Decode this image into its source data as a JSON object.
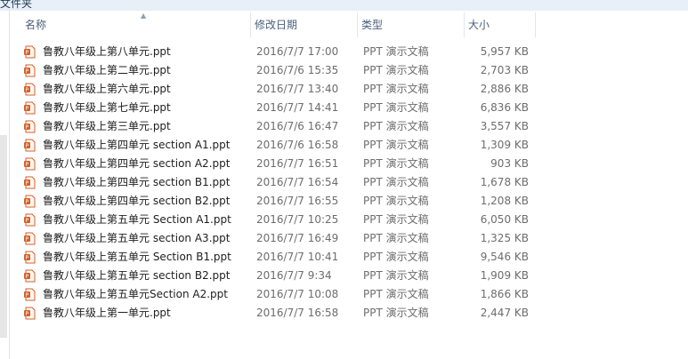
{
  "window": {
    "title_fragment": "文件夹"
  },
  "columns": {
    "name": "名称",
    "date": "修改日期",
    "type": "类型",
    "size": "大小"
  },
  "colors": {
    "header_text": "#4c607a",
    "icon_accent": "#d3622b"
  },
  "files": [
    {
      "name": "鲁教八年级上第八单元.ppt",
      "date": "2016/7/7 17:00",
      "type": "PPT 演示文稿",
      "size": "5,957 KB"
    },
    {
      "name": "鲁教八年级上第二单元.ppt",
      "date": "2016/7/6 15:35",
      "type": "PPT 演示文稿",
      "size": "2,703 KB"
    },
    {
      "name": "鲁教八年级上第六单元.ppt",
      "date": "2016/7/7 13:40",
      "type": "PPT 演示文稿",
      "size": "2,886 KB"
    },
    {
      "name": "鲁教八年级上第七单元.ppt",
      "date": "2016/7/7 14:41",
      "type": "PPT 演示文稿",
      "size": "6,836 KB"
    },
    {
      "name": "鲁教八年级上第三单元.ppt",
      "date": "2016/7/6 16:47",
      "type": "PPT 演示文稿",
      "size": "3,557 KB"
    },
    {
      "name": "鲁教八年级上第四单元 section A1.ppt",
      "date": "2016/7/6 16:58",
      "type": "PPT 演示文稿",
      "size": "1,309 KB"
    },
    {
      "name": "鲁教八年级上第四单元 section A2.ppt",
      "date": "2016/7/7 16:51",
      "type": "PPT 演示文稿",
      "size": "903 KB"
    },
    {
      "name": "鲁教八年级上第四单元 section B1.ppt",
      "date": "2016/7/7 16:54",
      "type": "PPT 演示文稿",
      "size": "1,678 KB"
    },
    {
      "name": "鲁教八年级上第四单元 section B2.ppt",
      "date": "2016/7/7 16:55",
      "type": "PPT 演示文稿",
      "size": "1,208 KB"
    },
    {
      "name": "鲁教八年级上第五单元 Section A1.ppt",
      "date": "2016/7/7 10:25",
      "type": "PPT 演示文稿",
      "size": "6,050 KB"
    },
    {
      "name": "鲁教八年级上第五单元 section A3.ppt",
      "date": "2016/7/7 16:49",
      "type": "PPT 演示文稿",
      "size": "1,325 KB"
    },
    {
      "name": "鲁教八年级上第五单元 Section B1.ppt",
      "date": "2016/7/7 10:41",
      "type": "PPT 演示文稿",
      "size": "9,546 KB"
    },
    {
      "name": "鲁教八年级上第五单元 section B2.ppt",
      "date": "2016/7/7 9:34",
      "type": "PPT 演示文稿",
      "size": "1,909 KB"
    },
    {
      "name": "鲁教八年级上第五单元Section A2.ppt",
      "date": "2016/7/7 10:08",
      "type": "PPT 演示文稿",
      "size": "1,866 KB"
    },
    {
      "name": "鲁教八年级上第一单元.ppt",
      "date": "2016/7/7 16:58",
      "type": "PPT 演示文稿",
      "size": "2,447 KB"
    }
  ]
}
